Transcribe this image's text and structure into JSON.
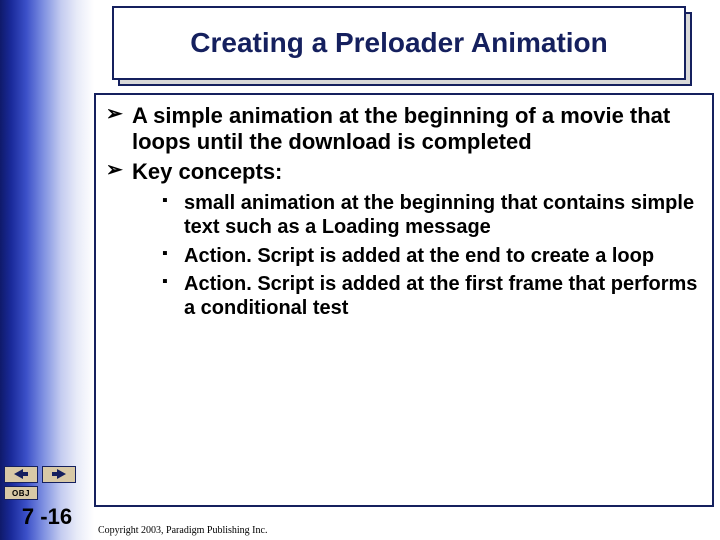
{
  "title": "Creating a Preloader Animation",
  "bullets": {
    "b1": "A simple animation at the beginning of a movie that loops until the download is completed",
    "b2": "Key concepts:",
    "sub1": "small animation at the beginning that contains simple text such as a Loading message",
    "sub2": "Action. Script is added at the end to create a loop",
    "sub3": "Action. Script is added at the first frame that performs a conditional test"
  },
  "nav": {
    "obj_label": "OBJ"
  },
  "page_number": "7 -16",
  "copyright": "Copyright 2003, Paradigm Publishing Inc."
}
